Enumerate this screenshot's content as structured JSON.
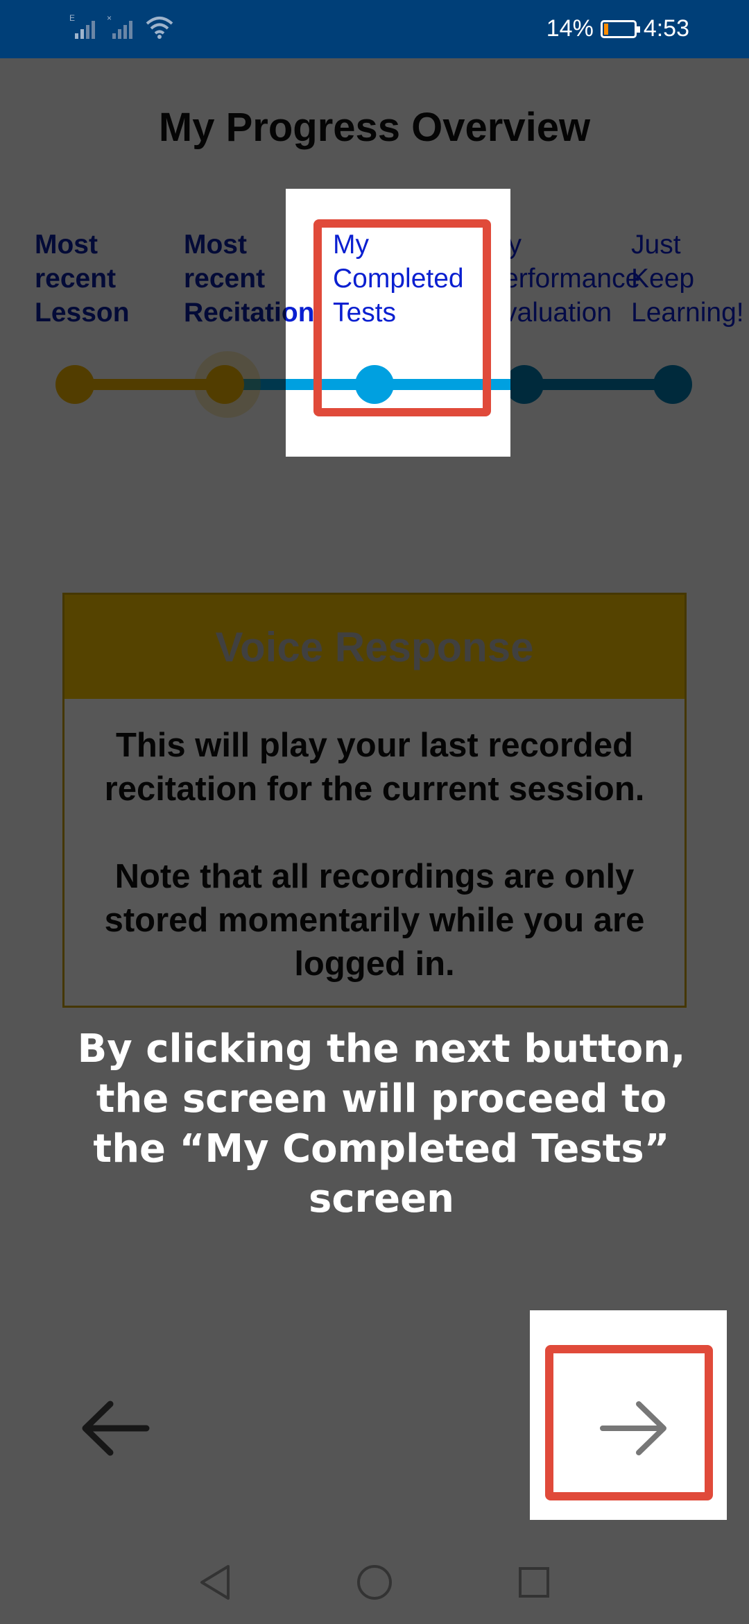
{
  "status_bar": {
    "battery_percent": "14%",
    "time": "4:53",
    "battery_level": 0.14,
    "icons": [
      "signal-e-icon",
      "signal-x-icon",
      "wifi-icon",
      "battery-icon"
    ]
  },
  "title": "My Progress Overview",
  "steps": [
    {
      "label_lines": [
        "Most",
        "recent",
        "Lesson"
      ],
      "state": "done"
    },
    {
      "label_lines": [
        "Most",
        "recent",
        "Recitation"
      ],
      "state": "current"
    },
    {
      "label_lines": [
        "My",
        "Completed",
        "Tests"
      ],
      "state": "highlighted"
    },
    {
      "label_lines": [
        "My",
        "Performance",
        "Evaluation"
      ],
      "state": "upcoming"
    },
    {
      "label_lines": [
        "Just",
        "Keep",
        "Learning!"
      ],
      "state": "upcoming"
    }
  ],
  "card": {
    "title": "Voice Response",
    "paragraph1": [
      "This will play your last recorded",
      "recitation for the current session."
    ],
    "paragraph2": [
      "Note that all recordings are only",
      "stored momentarily while you are",
      "logged in."
    ]
  },
  "caption": [
    "By clicking the next button,",
    "the screen will proceed to",
    "the “My Completed Tests”",
    "screen"
  ],
  "nav": {
    "back_icon": "arrow-left-icon",
    "next_icon": "arrow-right-icon"
  },
  "system_nav": {
    "icons": [
      "nav-back-triangle-icon",
      "nav-home-circle-icon",
      "nav-recents-square-icon"
    ]
  },
  "colors": {
    "status_bar": "#003f78",
    "done": "#f0b400",
    "progress_blue": "#00a0e0",
    "upcoming": "#007bb0",
    "card_header": "#f8c300",
    "highlight_frame": "#e04a3a",
    "step_text": "#0a1fa0"
  }
}
